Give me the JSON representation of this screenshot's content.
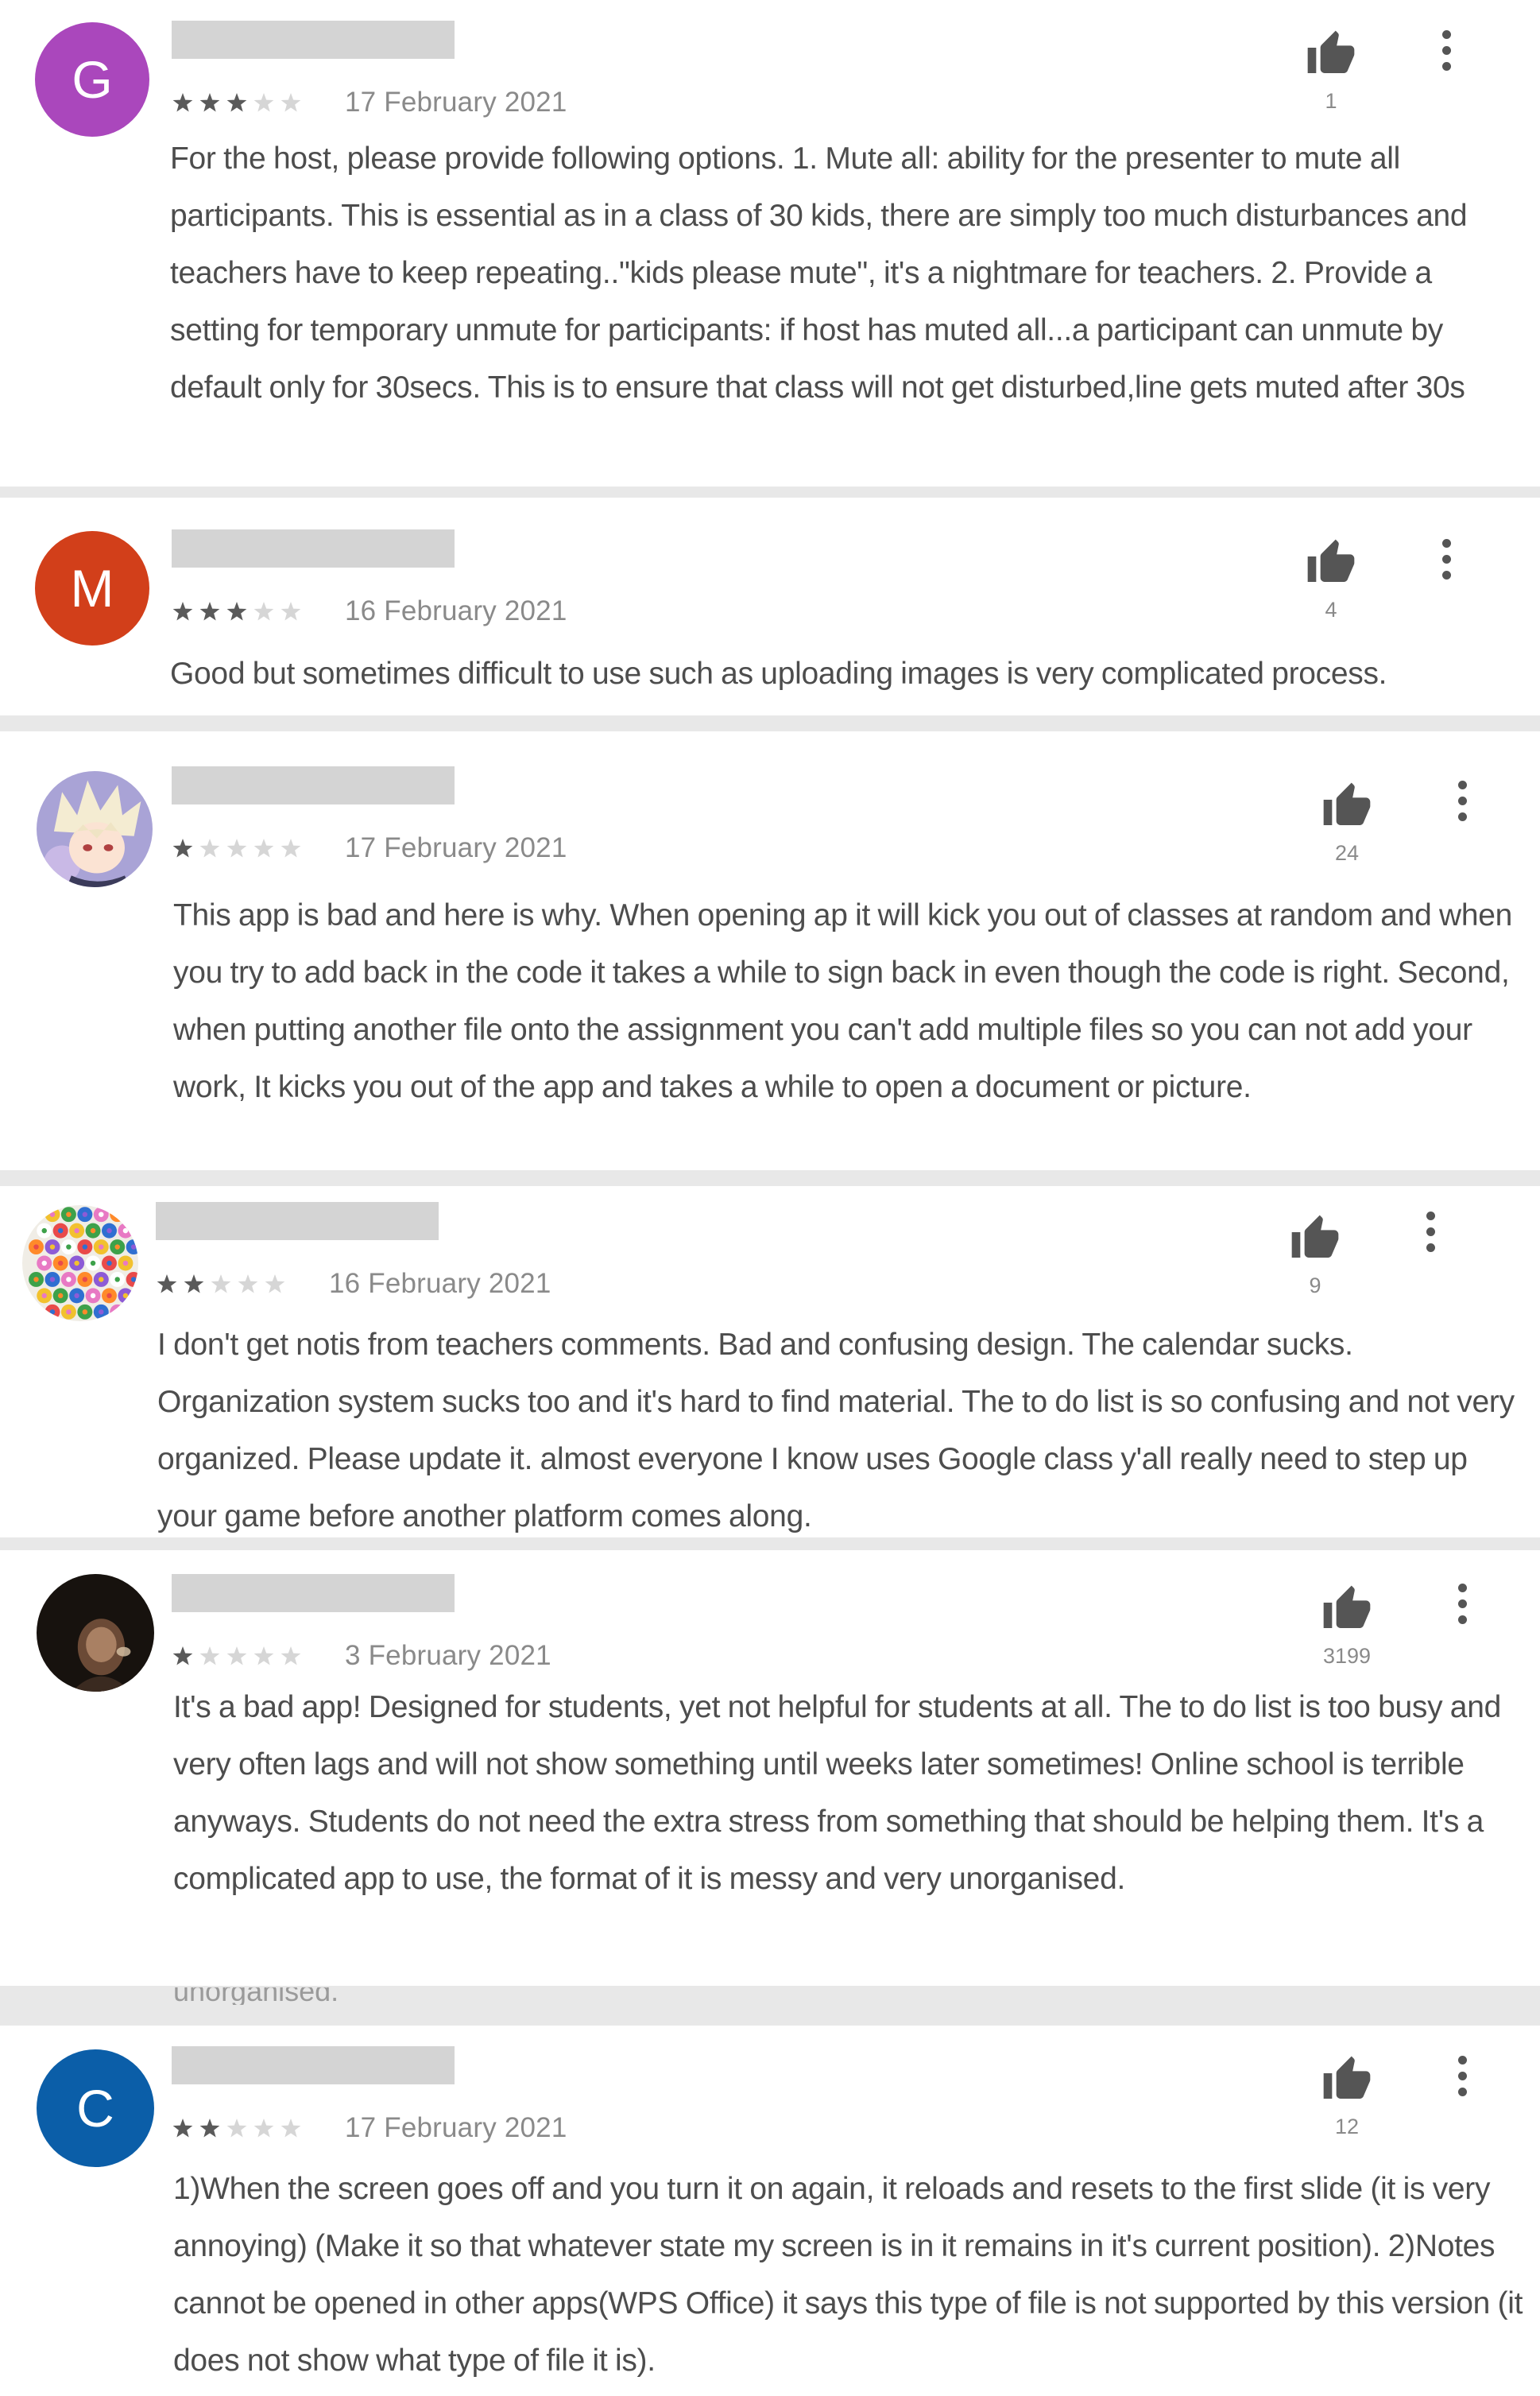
{
  "colors": {
    "separator": "#e8e8e8",
    "name_placeholder": "#d4d4d4",
    "star_filled": "#5a5a5a",
    "star_empty": "#d6d6d6",
    "meta_text": "#8a8a8a",
    "body_text": "#4d4d4d",
    "icon": "#555555"
  },
  "reviews": [
    {
      "avatar": {
        "type": "letter",
        "letter": "G",
        "color": "#aa47bc"
      },
      "rating": 3,
      "max_rating": 5,
      "date": "17 February 2021",
      "likes": "1",
      "like_icon": "thumbs-up-icon",
      "menu_icon": "more-vertical-icon",
      "text": "For the host, please provide following options. 1. Mute all: ability for the presenter to mute all participants. This is essential as in a class of 30 kids, there are simply too much disturbances and teachers have to keep repeating..\"kids please mute\", it's a nightmare for teachers. 2. Provide a setting for temporary unmute for participants: if host has muted all...a participant can unmute by default only for 30secs. This is to ensure that class will not get disturbed,line gets muted after 30s"
    },
    {
      "avatar": {
        "type": "letter",
        "letter": "M",
        "color": "#d23f1a"
      },
      "rating": 3,
      "max_rating": 5,
      "date": "16 February 2021",
      "likes": "4",
      "like_icon": "thumbs-up-icon",
      "menu_icon": "more-vertical-icon",
      "text": "Good but sometimes difficult to use such as uploading images is very complicated process."
    },
    {
      "avatar": {
        "type": "image",
        "icon": "anime-character-avatar-icon"
      },
      "rating": 1,
      "max_rating": 5,
      "date": "17 February 2021",
      "likes": "24",
      "like_icon": "thumbs-up-icon",
      "menu_icon": "more-vertical-icon",
      "text": "This app is bad and here is why. When opening ap it will kick you out of classes at random and when you try to add back in the code it takes a while to sign back in even though the code is right. Second, when putting another file onto the assignment you can't add multiple files so you can not add your work, It kicks you out of the app and takes a while to open a document or picture."
    },
    {
      "avatar": {
        "type": "image",
        "icon": "flower-ball-avatar-icon"
      },
      "rating": 2,
      "max_rating": 5,
      "date": "16 February 2021",
      "likes": "9",
      "like_icon": "thumbs-up-icon",
      "menu_icon": "more-vertical-icon",
      "text": "I don't get notis from teachers comments. Bad and confusing design. The calendar sucks. Organization system sucks too and it's hard to find material. The to do list is so confusing and not very organized. Please update it. almost everyone I know uses Google class y'all really need to step up your game before another platform comes along."
    },
    {
      "avatar": {
        "type": "image",
        "icon": "dark-photo-avatar-icon"
      },
      "rating": 1,
      "max_rating": 5,
      "date": "3 February 2021",
      "likes": "3199",
      "like_icon": "thumbs-up-icon",
      "menu_icon": "more-vertical-icon",
      "text": "It's a bad app! Designed for students, yet not helpful for students at all. The to do list is too busy and very often lags and will not show something until weeks later sometimes! Online school is terrible anyways. Students do not need the extra stress from something that should be helping them. It's a complicated app to use, the format of it is messy and very unorganised."
    },
    {
      "avatar": {
        "type": "letter",
        "letter": "C",
        "color": "#0b5ea8"
      },
      "rating": 2,
      "max_rating": 5,
      "date": "17 February 2021",
      "likes": "12",
      "like_icon": "thumbs-up-icon",
      "menu_icon": "more-vertical-icon",
      "text": "1)When the screen goes off and you turn it on again, it reloads and resets to the first slide (it is very annoying) (Make it so that whatever state my screen is in it remains in it's current position). 2)Notes cannot be opened in other apps(WPS Office) it says this type of file is not supported by this version (it does not show what type of file it is)."
    }
  ],
  "ghost_fragments": [
    "unorganised."
  ]
}
